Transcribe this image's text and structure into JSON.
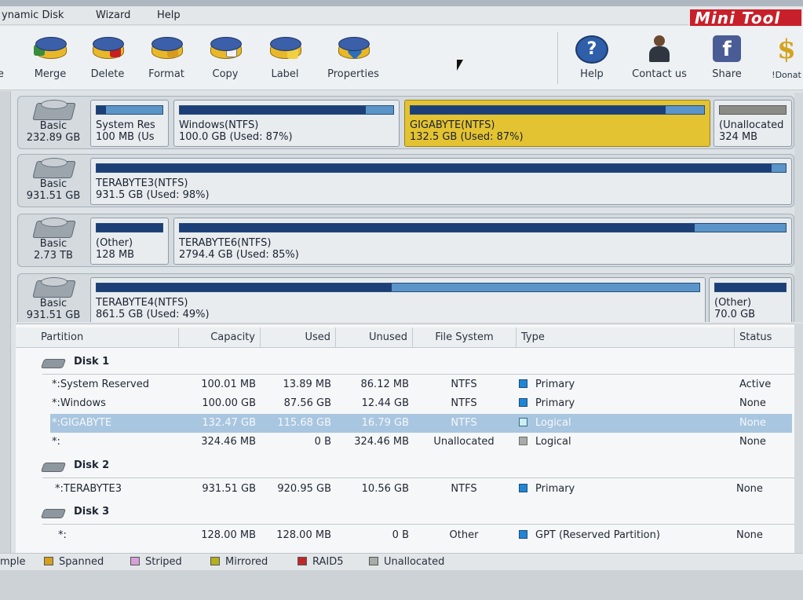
{
  "menu": [
    "ynamic Disk",
    "Wizard",
    "Help"
  ],
  "brand": "Mini Tool",
  "toolbar": {
    "left_cut": "ze",
    "items": [
      {
        "label": "Merge",
        "icon": "merge-icon"
      },
      {
        "label": "Delete",
        "icon": "delete-icon"
      },
      {
        "label": "Format",
        "icon": "format-icon"
      },
      {
        "label": "Copy",
        "icon": "copy-icon"
      },
      {
        "label": "Label",
        "icon": "label-icon"
      },
      {
        "label": "Properties",
        "icon": "properties-icon"
      }
    ],
    "right_items": [
      {
        "label": "Help",
        "icon": "help-icon",
        "glyph": "?"
      },
      {
        "label": "Contact us",
        "icon": "contact-icon"
      },
      {
        "label": "Share",
        "icon": "facebook-icon",
        "glyph": "f"
      },
      {
        "label": "!Donat",
        "icon": "donate-icon",
        "glyph": "$"
      }
    ]
  },
  "disk_map": [
    {
      "type": "Basic",
      "size": "232.89 GB",
      "partitions": [
        {
          "name": "System Res",
          "info": "100 MB (Us",
          "used_fraction": 0.14
        },
        {
          "name": "Windows(NTFS)",
          "info": "100.0 GB (Used: 87%)",
          "used_fraction": 0.87
        },
        {
          "name": "GIGABYTE(NTFS)",
          "info": "132.5 GB (Used: 87%)",
          "used_fraction": 0.87,
          "selected": true
        },
        {
          "name": "(Unallocated",
          "info": "324 MB",
          "used_fraction": 0,
          "unallocated": true
        }
      ]
    },
    {
      "type": "Basic",
      "size": "931.51 GB",
      "partitions": [
        {
          "name": "TERABYTE3(NTFS)",
          "info": "931.5 GB (Used: 98%)",
          "used_fraction": 0.98
        }
      ]
    },
    {
      "type": "Basic",
      "size": "2.73 TB",
      "partitions": [
        {
          "name": "(Other)",
          "info": "128 MB",
          "used_fraction": 1.0
        },
        {
          "name": "TERABYTE6(NTFS)",
          "info": "2794.4 GB (Used: 85%)",
          "used_fraction": 0.85
        }
      ]
    },
    {
      "type": "Basic",
      "size": "931.51 GB",
      "partitions": [
        {
          "name": "TERABYTE4(NTFS)",
          "info": "861.5 GB (Used: 49%)",
          "used_fraction": 0.49
        },
        {
          "name": "(Other)",
          "info": "70.0 GB",
          "used_fraction": 1.0
        }
      ]
    }
  ],
  "table": {
    "columns": [
      "Partition",
      "Capacity",
      "Used",
      "Unused",
      "File System",
      "Type",
      "Status"
    ],
    "disk_groups": [
      {
        "name": "Disk 1",
        "rows": [
          {
            "partition": "*:System Reserved",
            "capacity": "100.01 MB",
            "used": "13.89 MB",
            "unused": "86.12 MB",
            "fs": "NTFS",
            "type": "Primary",
            "type_kind": "primary",
            "status": "Active"
          },
          {
            "partition": "*:Windows",
            "capacity": "100.00 GB",
            "used": "87.56 GB",
            "unused": "12.44 GB",
            "fs": "NTFS",
            "type": "Primary",
            "type_kind": "primary",
            "status": "None"
          },
          {
            "partition": "*:GIGABYTE",
            "capacity": "132.47 GB",
            "used": "115.68 GB",
            "unused": "16.79 GB",
            "fs": "NTFS",
            "type": "Logical",
            "type_kind": "logical",
            "status": "None",
            "selected": true
          },
          {
            "partition": "*:",
            "capacity": "324.46 MB",
            "used": "0 B",
            "unused": "324.46 MB",
            "fs": "Unallocated",
            "type": "Logical",
            "type_kind": "unallocated",
            "status": "None"
          }
        ]
      },
      {
        "name": "Disk 2",
        "rows": [
          {
            "partition": "*:TERABYTE3",
            "capacity": "931.51 GB",
            "used": "920.95 GB",
            "unused": "10.56 GB",
            "fs": "NTFS",
            "type": "Primary",
            "type_kind": "primary",
            "status": "None"
          }
        ]
      },
      {
        "name": "Disk 3",
        "rows": [
          {
            "partition": "*:",
            "capacity": "128.00 MB",
            "used": "128.00 MB",
            "unused": "0 B",
            "fs": "Other",
            "type": "GPT (Reserved Partition)",
            "type_kind": "primary",
            "status": "None"
          }
        ]
      }
    ]
  },
  "legend": [
    {
      "label": "mple",
      "color": null
    },
    {
      "label": "Spanned",
      "color": "#d4a020"
    },
    {
      "label": "Striped",
      "color": "#d6a0d8"
    },
    {
      "label": "Mirrored",
      "color": "#b4b020"
    },
    {
      "label": "RAID5",
      "color": "#c02828"
    },
    {
      "label": "Unallocated",
      "color": "#a8aca8"
    }
  ],
  "colors": {
    "selected_partition": "#e4c332",
    "selected_row": "#a9c6e0",
    "bar_used": "#1c3f78",
    "bar_free": "#5b94c9"
  }
}
